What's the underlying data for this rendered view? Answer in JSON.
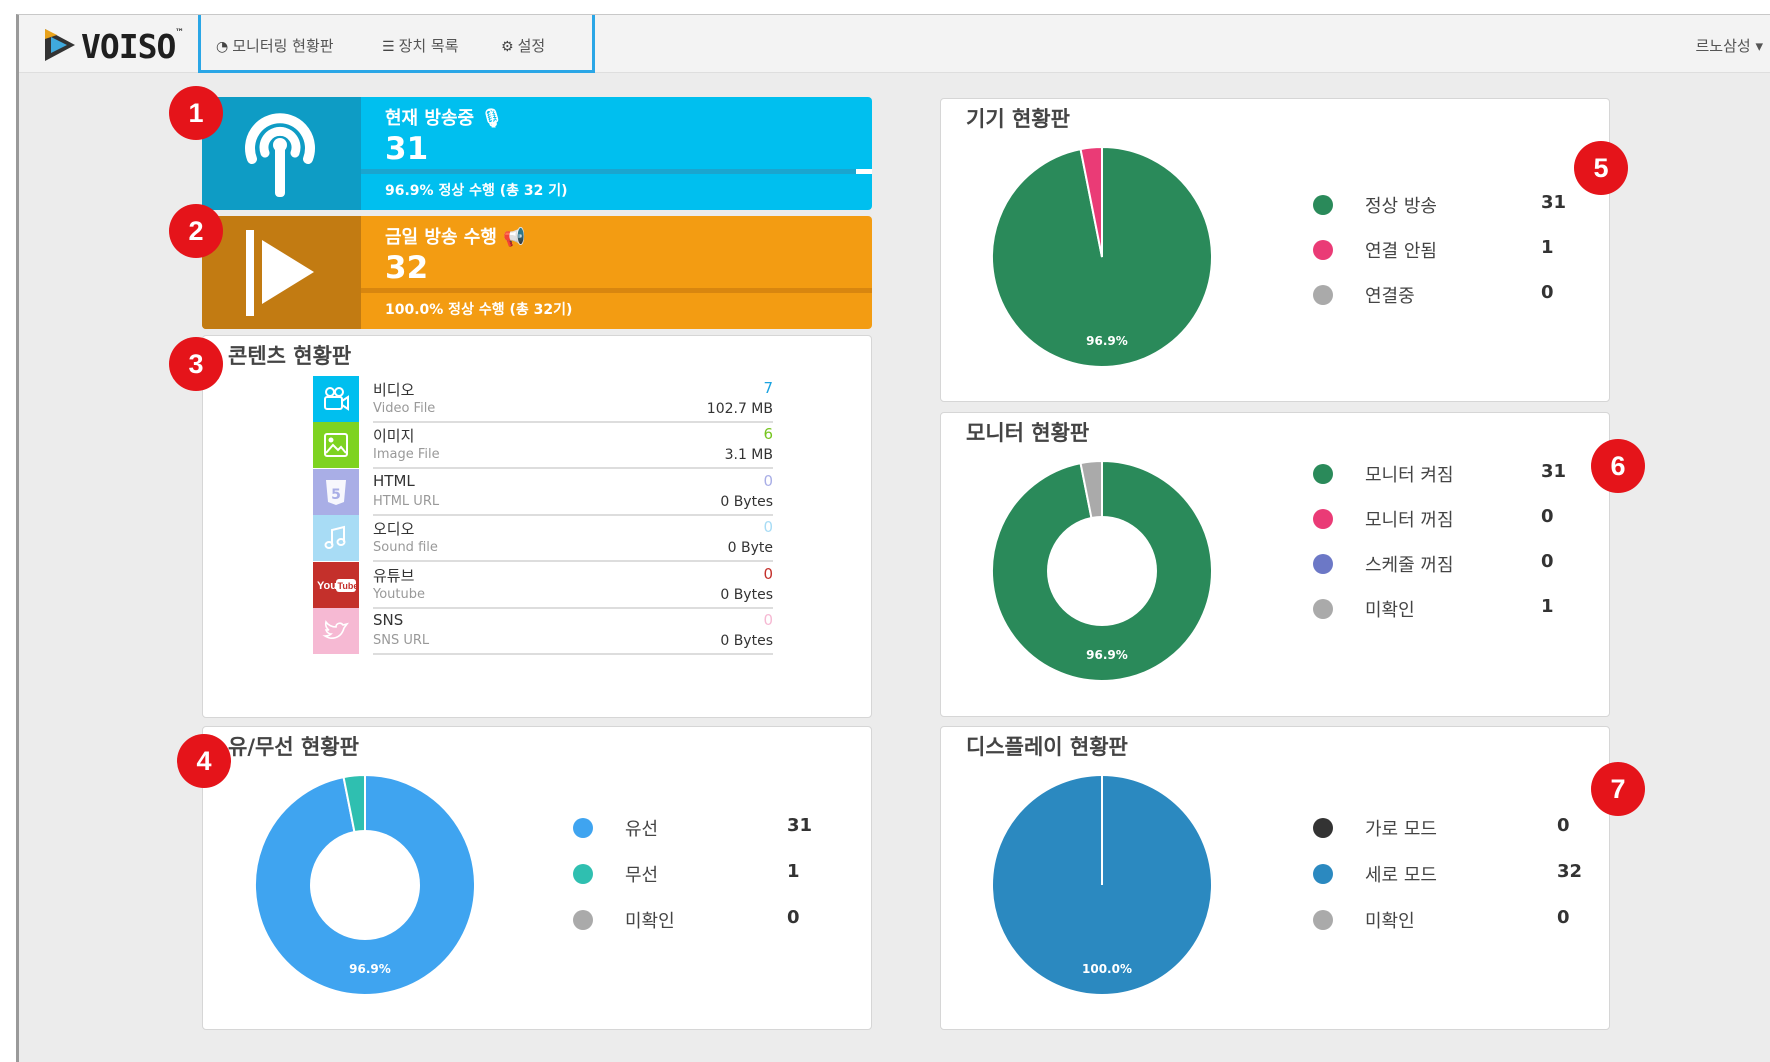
{
  "app": {
    "logo_text": "VOISO",
    "trademark": "™"
  },
  "nav": {
    "items": [
      {
        "label": "모니터링 현황판",
        "icon": "dashboard-icon"
      },
      {
        "label": "장치 목록",
        "icon": "list-icon"
      },
      {
        "label": "설정",
        "icon": "gear-icon"
      }
    ],
    "user": "르노삼성 ▾"
  },
  "badges": [
    "1",
    "2",
    "3",
    "4",
    "5",
    "6",
    "7"
  ],
  "tiles": {
    "broadcasting": {
      "title": "현재 방송중",
      "title_icon": "microphone-icon",
      "value": "31",
      "subtitle": "96.9% 정상 수행 (총 32 기)",
      "progress": 0.969,
      "color": "#00bfef",
      "icon_bg": "#0e9cc5",
      "icon": "broadcast-icon"
    },
    "today": {
      "title": "금일 방송 수행",
      "title_icon": "megaphone-icon",
      "value": "32",
      "subtitle": "100.0% 정상 수행 (총 32기)",
      "progress": 1.0,
      "color": "#f39c12",
      "icon_bg": "#c27b12",
      "icon": "play-icon"
    }
  },
  "contents": {
    "title": "콘텐츠 현황판",
    "items": [
      {
        "name": "비디오",
        "sub": "Video File",
        "count": "7",
        "size": "102.7 MB",
        "color": "#00bfef",
        "count_color": "#1ba3e0",
        "icon": "video-camera-icon"
      },
      {
        "name": "이미지",
        "sub": "Image File",
        "count": "6",
        "size": "3.1 MB",
        "color": "#7ed321",
        "count_color": "#76c51f",
        "icon": "image-icon"
      },
      {
        "name": "HTML",
        "sub": "HTML URL",
        "count": "0",
        "size": "0 Bytes",
        "color": "#a9aee6",
        "count_color": "#a9aee6",
        "icon": "html5-icon"
      },
      {
        "name": "오디오",
        "sub": "Sound file",
        "count": "0",
        "size": "0 Byte",
        "color": "#a8dcf5",
        "count_color": "#a8dcf5",
        "icon": "music-note-icon"
      },
      {
        "name": "유튜브",
        "sub": "Youtube",
        "count": "0",
        "size": "0 Bytes",
        "color": "#c4302b",
        "count_color": "#c4302b",
        "icon": "youtube-icon"
      },
      {
        "name": "SNS",
        "sub": "SNS URL",
        "count": "0",
        "size": "0 Bytes",
        "color": "#f6b9d3",
        "count_color": "#f6b9d3",
        "icon": "twitter-bird-icon"
      }
    ]
  },
  "panels": {
    "device": {
      "title": "기기 현황판",
      "legend": [
        {
          "label": "정상 방송",
          "count": "31",
          "color": "#2a8a5a"
        },
        {
          "label": "연결 안됨",
          "count": "1",
          "color": "#ea3b76"
        },
        {
          "label": "연결중",
          "count": "0",
          "color": "#aaaaaa"
        }
      ]
    },
    "monitor": {
      "title": "모니터 현황판",
      "legend": [
        {
          "label": "모니터 켜짐",
          "count": "31",
          "color": "#2a8a5a"
        },
        {
          "label": "모니터 꺼짐",
          "count": "0",
          "color": "#ea3b76"
        },
        {
          "label": "스케줄 꺼짐",
          "count": "0",
          "color": "#6c78c6"
        },
        {
          "label": "미확인",
          "count": "1",
          "color": "#aaaaaa"
        }
      ]
    },
    "network": {
      "title": "유/무선 현황판",
      "legend": [
        {
          "label": "유선",
          "count": "31",
          "color": "#3fa4f0"
        },
        {
          "label": "무선",
          "count": "1",
          "color": "#2fbfb0"
        },
        {
          "label": "미확인",
          "count": "0",
          "color": "#aaaaaa"
        }
      ]
    },
    "display": {
      "title": "디스플레이 현황판",
      "legend": [
        {
          "label": "가로 모드",
          "count": "0",
          "color": "#333333"
        },
        {
          "label": "세로 모드",
          "count": "32",
          "color": "#2b89c0"
        },
        {
          "label": "미확인",
          "count": "0",
          "color": "#aaaaaa"
        }
      ]
    }
  },
  "chart_data": [
    {
      "type": "pie",
      "id": "device",
      "slices": [
        {
          "label": "정상 방송",
          "value": 31,
          "color": "#2a8a5a"
        },
        {
          "label": "연결 안됨",
          "value": 1,
          "color": "#ea3b76"
        }
      ],
      "label": "96.9%"
    },
    {
      "type": "pie",
      "id": "monitor",
      "donut": true,
      "slices": [
        {
          "label": "모니터 켜짐",
          "value": 31,
          "color": "#2a8a5a"
        },
        {
          "label": "미확인",
          "value": 1,
          "color": "#aaaaaa"
        }
      ],
      "label": "96.9%"
    },
    {
      "type": "pie",
      "id": "network",
      "donut": true,
      "slices": [
        {
          "label": "유선",
          "value": 31,
          "color": "#3fa4f0"
        },
        {
          "label": "무선",
          "value": 1,
          "color": "#2fbfb0"
        }
      ],
      "label": "96.9%"
    },
    {
      "type": "pie",
      "id": "display",
      "slices": [
        {
          "label": "세로 모드",
          "value": 32,
          "color": "#2b89c0"
        }
      ],
      "label": "100.0%"
    }
  ]
}
